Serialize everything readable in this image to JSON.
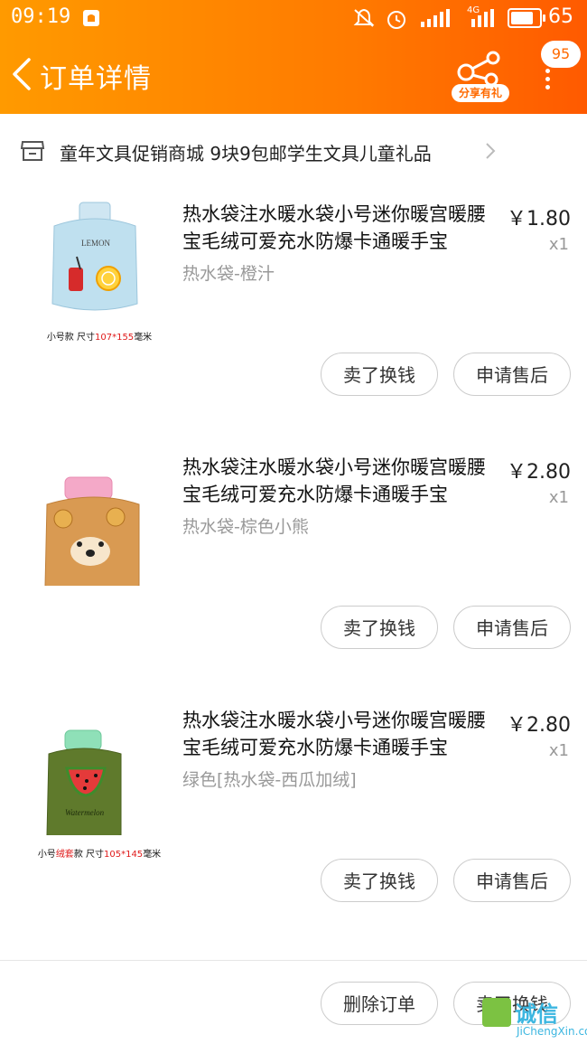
{
  "status_bar": {
    "time": "09:19",
    "network": "4G",
    "battery": "65"
  },
  "nav": {
    "title": "订单详情",
    "share_label": "分享有礼",
    "badge": "95"
  },
  "shop": {
    "name": "童年文具促销商城  9块9包邮学生文具儿童礼品"
  },
  "items": [
    {
      "title": "热水袋注水暖水袋小号迷你暖宫暖腰宝毛绒可爱充水防爆卡通暖手宝",
      "price": "￥1.80",
      "qty": "x1",
      "sku": "热水袋-橙汁",
      "caption_a": "小号款  尺寸",
      "caption_b": "107*155",
      "caption_c": "毫米",
      "thumb_text": "LEMON",
      "sell_label": "卖了换钱",
      "after_label": "申请售后"
    },
    {
      "title": "热水袋注水暖水袋小号迷你暖宫暖腰宝毛绒可爱充水防爆卡通暖手宝",
      "price": "￥2.80",
      "qty": "x1",
      "sku": "热水袋-棕色小熊",
      "sell_label": "卖了换钱",
      "after_label": "申请售后"
    },
    {
      "title": "热水袋注水暖水袋小号迷你暖宫暖腰宝毛绒可爱充水防爆卡通暖手宝",
      "price": "￥2.80",
      "qty": "x1",
      "sku": "绿色[热水袋-西瓜加绒]",
      "caption_a": "小号",
      "caption_b": "绒套",
      "caption_c": "款  尺寸",
      "caption_d": "105*145",
      "caption_e": "毫米",
      "thumb_text": "Watermelon",
      "sell_label": "卖了换钱",
      "after_label": "申请售后"
    }
  ],
  "footer": {
    "delete_label": "删除订单",
    "sell_label": "卖了换钱"
  },
  "watermark": {
    "brand": "诚信",
    "site": "JiChengXin.com"
  },
  "colors": {
    "header_orange": "#ff7a00",
    "text_gray": "#999999"
  }
}
